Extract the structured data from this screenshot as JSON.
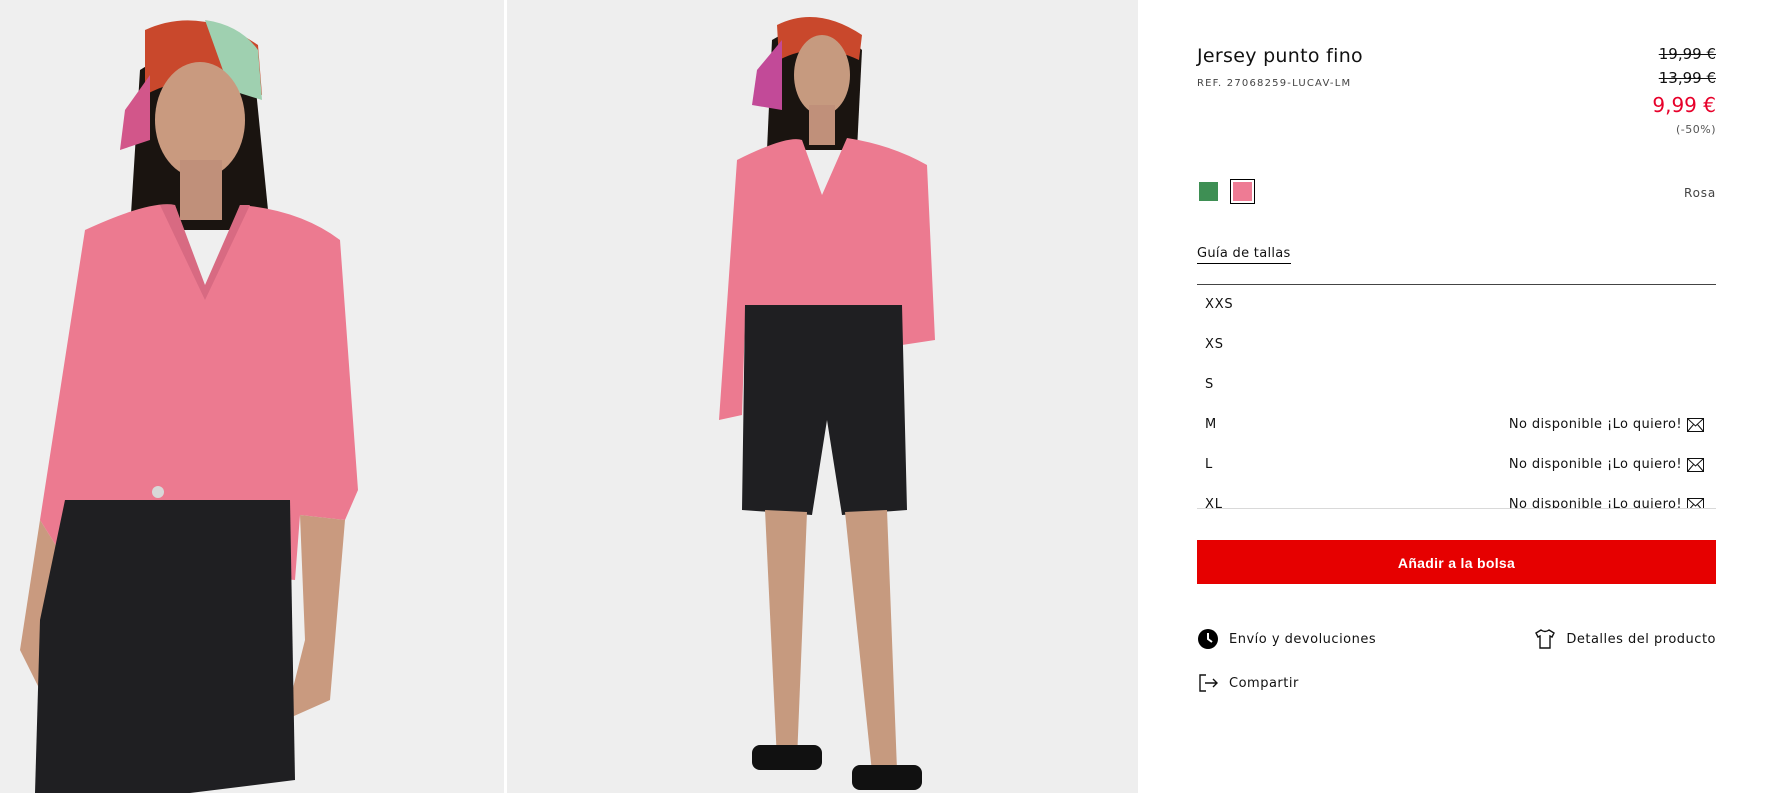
{
  "product": {
    "title": "Jersey punto fino",
    "ref": "REF. 27068259-LUCAV-LM",
    "price_original": "19,99 €",
    "price_previous": "13,99 €",
    "price_current": "9,99 €",
    "discount": "(-50%)"
  },
  "colors": {
    "options": [
      {
        "name": "green-swatch",
        "hex": "#3e8f54"
      },
      {
        "name": "pink-swatch",
        "hex": "#ee7b94"
      }
    ],
    "selected_label": "Rosa"
  },
  "size_guide_label": "Guía de tallas",
  "sizes": [
    {
      "label": "XXS",
      "status": ""
    },
    {
      "label": "XS",
      "status": ""
    },
    {
      "label": "S",
      "status": ""
    },
    {
      "label": "M",
      "status": "No disponible ¡Lo quiero!"
    },
    {
      "label": "L",
      "status": "No disponible ¡Lo quiero!"
    },
    {
      "label": "XL",
      "status": "No disponible ¡Lo quiero!"
    }
  ],
  "add_to_bag_label": "Añadir a la bolsa",
  "links": {
    "shipping": "Envío y devoluciones",
    "details": "Detalles del producto",
    "share": "Compartir"
  },
  "theme": {
    "accent": "#e60000",
    "sale": "#e7002a"
  }
}
